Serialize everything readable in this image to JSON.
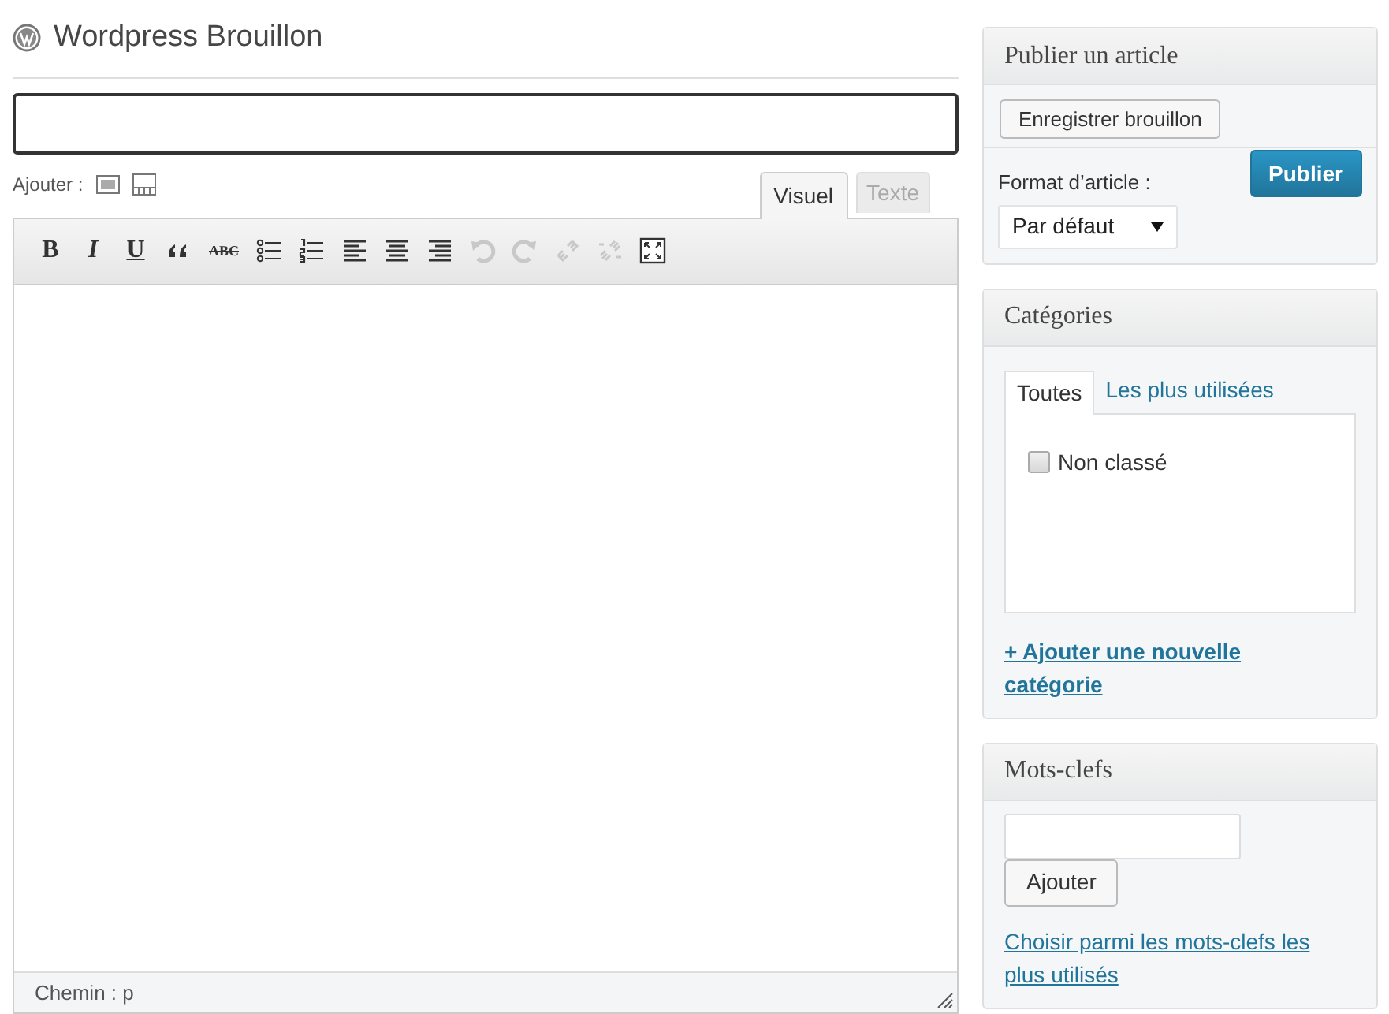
{
  "page": {
    "title": "Wordpress Brouillon"
  },
  "editor": {
    "add_label": "Ajouter :",
    "tabs": [
      {
        "label": "Visuel",
        "selected": true
      },
      {
        "label": "Texte",
        "selected": false
      }
    ],
    "tools": [
      {
        "kind": "bold",
        "label": "B",
        "disabled": false
      },
      {
        "kind": "italic",
        "label": "I",
        "disabled": false
      },
      {
        "kind": "underline",
        "label": "U",
        "disabled": false
      },
      {
        "kind": "quote",
        "disabled": false
      },
      {
        "kind": "strike",
        "label": "ABC",
        "disabled": false
      },
      {
        "kind": "ul",
        "disabled": false
      },
      {
        "kind": "ol",
        "disabled": false
      },
      {
        "kind": "left",
        "disabled": false
      },
      {
        "kind": "center",
        "disabled": false
      },
      {
        "kind": "right",
        "disabled": false
      },
      {
        "kind": "undo",
        "disabled": true
      },
      {
        "kind": "redo",
        "disabled": true
      },
      {
        "kind": "link",
        "disabled": true
      },
      {
        "kind": "unlink",
        "disabled": true
      },
      {
        "kind": "fullscreen",
        "disabled": false
      }
    ],
    "path": "Chemin : p"
  },
  "publish": {
    "title": "Publier un article",
    "save_button": "Enregistrer brouillon",
    "publish_button": "Publier",
    "format_label": "Format d’article :",
    "format_value": "Par défaut"
  },
  "categories": {
    "title": "Catégories",
    "tabs": [
      {
        "label": "Toutes",
        "selected": true
      },
      {
        "label": "Les plus utilisées",
        "selected": false
      }
    ],
    "items": [
      {
        "label": "Non classé",
        "checked": false
      }
    ],
    "add_link": "+ Ajouter une nouvelle catégorie"
  },
  "tags": {
    "title": "Mots-clefs",
    "add_button": "Ajouter",
    "choose_link": "Choisir parmi les mots-clefs les plus utilisés"
  }
}
